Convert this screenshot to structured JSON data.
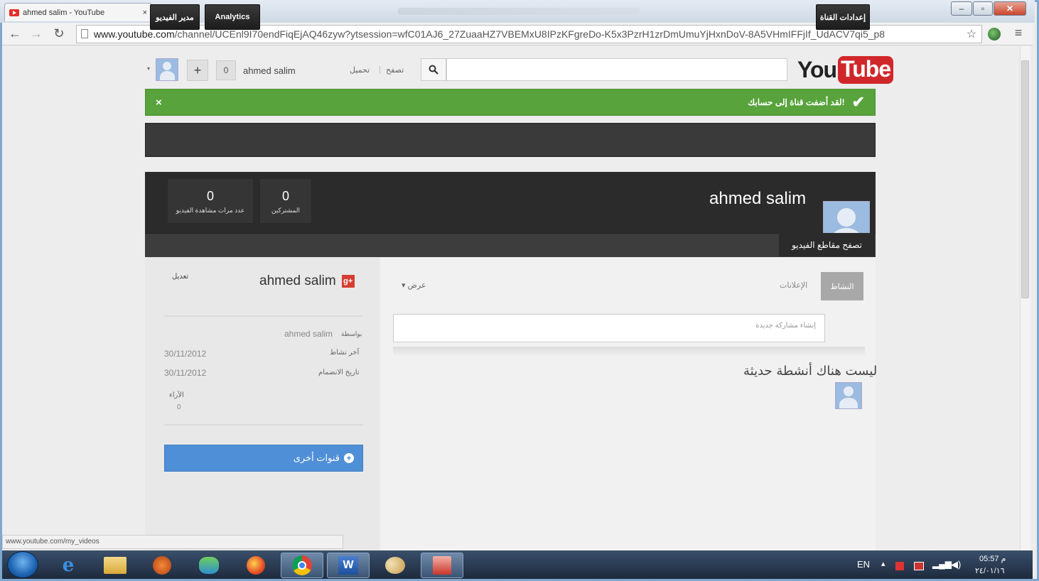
{
  "browser": {
    "tab_title": "ahmed salim - YouTube",
    "tab_close": "×",
    "url_host": "www.youtube.com",
    "url_path": "/channel/UCEnl9I70endFiqEjAQ46zyw?ytsession=wfC01AJ6_27ZuaaHZ7VBEMxU8IPzKFgreDo-K5x3PzrH1zrDmUmuYjHxnDoV-8A5VHmIFFjIf_UdACV7qi5_p8",
    "window_buttons": [
      "–",
      "▫",
      "✕"
    ],
    "nav": {
      "back": "←",
      "forward": "→",
      "reload": "↻",
      "menu": "≡",
      "star": "☆"
    },
    "status_url": "www.youtube.com/my_videos"
  },
  "header": {
    "logo_you": "You",
    "logo_tube": "Tube",
    "search_placeholder": "",
    "upload_label": "تحميل",
    "browse_label": "تصفح",
    "user_name": "ahmed salim",
    "notifications_count": "0",
    "plus_label": "+",
    "drop_arrow": "▾",
    "search_icon": "search-icon"
  },
  "banner": {
    "message": "لقد أضفت قناة إلى حسابك!",
    "close": "×",
    "check": "✔"
  },
  "dashboard_bar": {
    "video_manager": "مدير الفيديو",
    "analytics": "Analytics",
    "channel_settings": "إعدادات القناة"
  },
  "channel": {
    "name": "ahmed salim",
    "stats": [
      {
        "value": "0",
        "label": "عدد مرات مشاهدة الفيديو"
      },
      {
        "value": "0",
        "label": "المشتركين"
      }
    ],
    "browse_videos": "تصفح مقاطع الفيديو"
  },
  "sidebar": {
    "gplus_name": "ahmed salim",
    "gplus_icon": "g+",
    "edit": "تعديل",
    "by_label": "بواسطة",
    "by_value": "ahmed salim",
    "rows": [
      {
        "label": "آخر نشاط",
        "value": "30/11/2012"
      },
      {
        "label": "تاريخ الانضمام",
        "value": "30/11/2012"
      },
      {
        "label": "الآراء",
        "value": "0"
      }
    ],
    "more_channels": "قنوات أخرى"
  },
  "feed": {
    "tab_activity": "النشاط",
    "tab_posts": "الإعلانات",
    "view_dropdown": "عرض",
    "post_placeholder": "إنشاء مشاركة جديدة",
    "empty_message": "ليست هناك أنشطة حديثة"
  },
  "taskbar": {
    "lang": "EN",
    "time": "05:57 م",
    "date": "٢٤/٠١/١٦"
  }
}
